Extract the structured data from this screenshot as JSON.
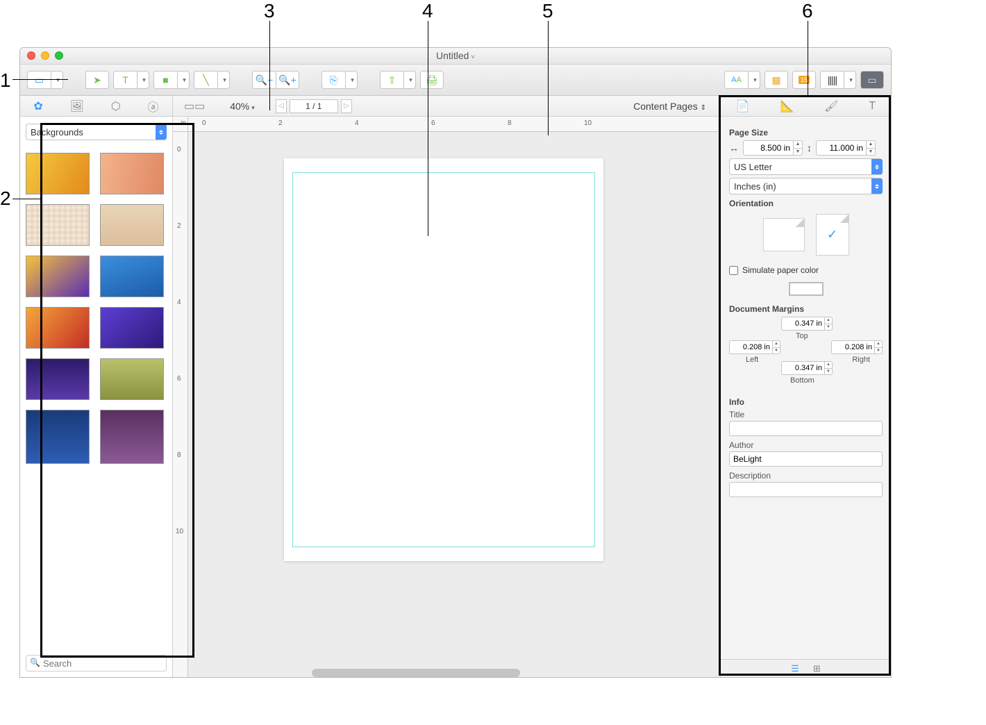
{
  "callouts": {
    "n1": "1",
    "n2": "2",
    "n3": "3",
    "n4": "4",
    "n5": "5",
    "n6": "6"
  },
  "window": {
    "title": "Untitled"
  },
  "subbar": {
    "zoom": "40%",
    "page_indicator": "1 / 1",
    "section": "Content Pages"
  },
  "source_panel": {
    "category": "Backgrounds",
    "search_placeholder": "Search"
  },
  "ruler": {
    "unit": "in",
    "h_ticks": [
      "0",
      "2",
      "4",
      "6",
      "8",
      "10"
    ],
    "v_ticks": [
      "0",
      "2",
      "4",
      "6",
      "8",
      "10"
    ]
  },
  "inspector": {
    "page_size_label": "Page Size",
    "width": "8.500 in",
    "height": "11.000 in",
    "preset": "US Letter",
    "units": "Inches (in)",
    "orientation_label": "Orientation",
    "simulate_label": "Simulate paper color",
    "margins_label": "Document Margins",
    "margin_top": "0.347 in",
    "margin_top_label": "Top",
    "margin_left": "0.208 in",
    "margin_left_label": "Left",
    "margin_right": "0.208 in",
    "margin_right_label": "Right",
    "margin_bottom": "0.347 in",
    "margin_bottom_label": "Bottom",
    "info_label": "Info",
    "title_label": "Title",
    "title_value": "",
    "author_label": "Author",
    "author_value": "BeLight",
    "description_label": "Description"
  },
  "thumb_styles": [
    "background:linear-gradient(120deg,#f5c93d,#e28a1c);",
    "background:linear-gradient(100deg,#f3b38c,#e08963);",
    "background:radial-gradient(#f5efe7,#e6cfb2);background-size:8px 8px;",
    "background:linear-gradient(#e9d4b7,#dcbf9d);",
    "background:linear-gradient(140deg,#f6c23a,#5a2db3);",
    "background:linear-gradient(160deg,#3a8fe0,#1d5ca8);",
    "background:linear-gradient(130deg,#f6a63a,#c42d25);",
    "background:linear-gradient(140deg,#5d3fd3,#2e1a7a);",
    "background:linear-gradient(#2c1b6b,#5a3aa8);",
    "background:linear-gradient(#b9c26a,#8a9240);",
    "background:linear-gradient(#1a3a7a,#2e5db3);",
    "background:linear-gradient(#5a3060,#8a5a95);"
  ]
}
